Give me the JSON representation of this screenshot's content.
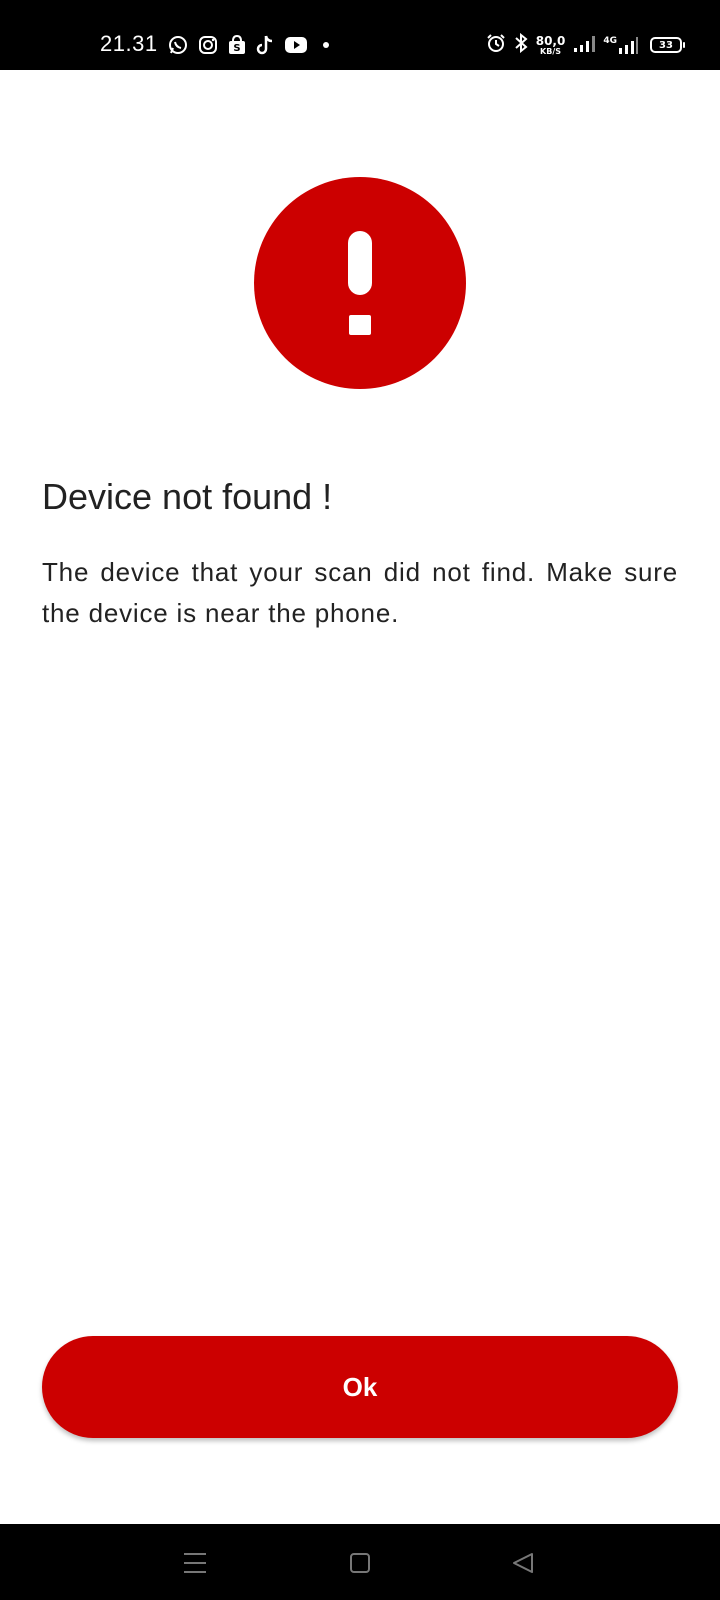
{
  "status_bar": {
    "time": "21.31",
    "net_speed_value": "80,0",
    "net_speed_unit": "KB/S",
    "network_type": "4G",
    "battery": "33",
    "notification_icons": [
      "whatsapp-icon",
      "instagram-icon",
      "shopee-icon",
      "tiktok-icon",
      "youtube-icon",
      "more-dot-icon"
    ],
    "system_icons": [
      "alarm-icon",
      "bluetooth-icon",
      "signal-icon",
      "signal-4g-icon",
      "battery-icon"
    ]
  },
  "dialog": {
    "icon": "alert-circle-icon",
    "title": "Device not found !",
    "message": "The device that your scan did not find. Make sure the device is near the phone.",
    "ok_label": "Ok"
  },
  "nav_bar": {
    "buttons": [
      "menu-icon",
      "home-icon",
      "back-icon"
    ]
  },
  "colors": {
    "accent": "#cc0000",
    "text": "#222222",
    "background": "#ffffff",
    "system_bar": "#000000"
  }
}
